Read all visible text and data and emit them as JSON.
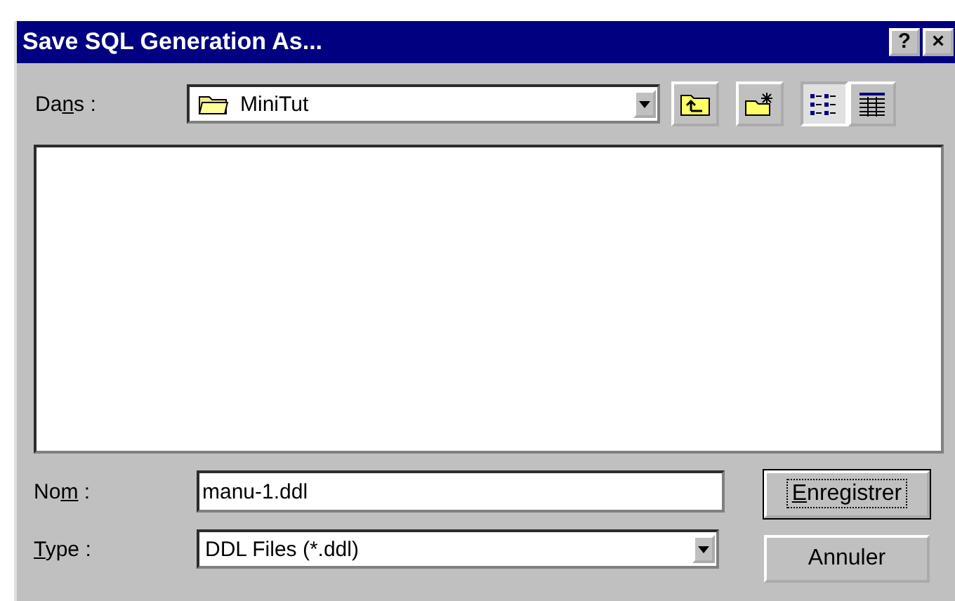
{
  "window": {
    "title": "Save SQL Generation As...",
    "title_buttons": [
      "?",
      "×"
    ]
  },
  "look_in": {
    "label": {
      "before": "Da",
      "key": "n",
      "after": "s :"
    },
    "value": "MiniTut"
  },
  "toolbar": [
    {
      "kind": "up-folder",
      "selected": false
    },
    {
      "kind": "new-folder",
      "selected": false
    },
    {
      "kind": "list-view",
      "selected": true
    },
    {
      "kind": "details-view",
      "selected": false
    }
  ],
  "file_name": {
    "label": {
      "before": "No",
      "key": "m",
      "after": " :"
    },
    "value": "manu-1.ddl"
  },
  "file_type": {
    "label": {
      "key": "T",
      "after": "ype :"
    },
    "value": "DDL Files (*.ddl)"
  },
  "buttons": [
    {
      "label": {
        "key": "E",
        "after": "nregistrer"
      },
      "default": true
    },
    {
      "label": {
        "before": "Annuler"
      },
      "default": false
    }
  ]
}
